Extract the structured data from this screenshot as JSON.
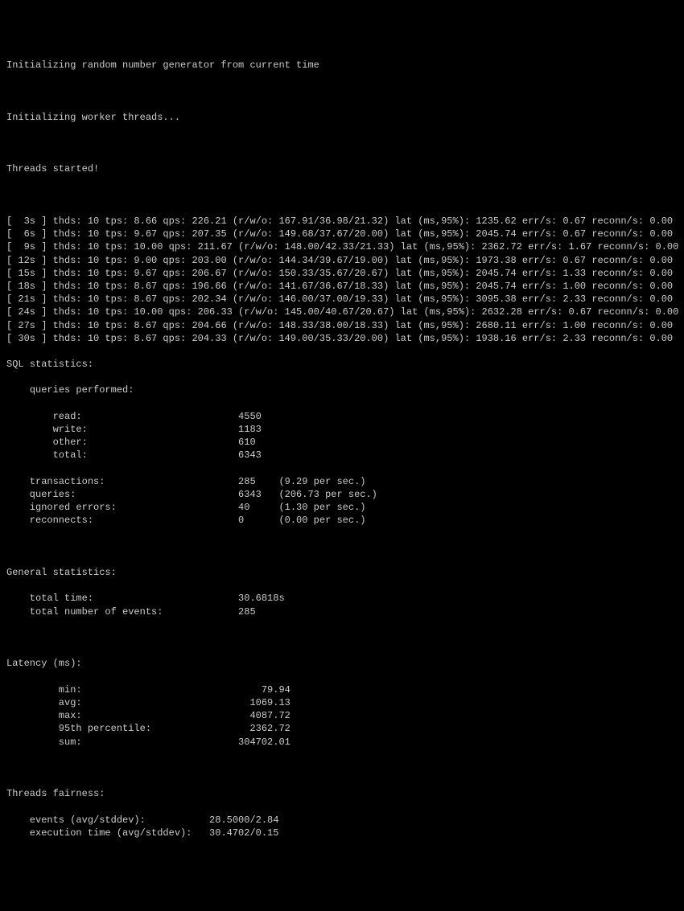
{
  "header": {
    "init_rng": "Initializing random number generator from current time",
    "init_workers": "Initializing worker threads...",
    "threads_started": "Threads started!"
  },
  "progress": [
    {
      "t": "3s",
      "thds": 10,
      "tps": "8.66",
      "qps": "226.21",
      "r": "167.91",
      "w": "36.98",
      "o": "21.32",
      "lat95": "1235.62",
      "err": "0.67",
      "reconn": "0.00"
    },
    {
      "t": "6s",
      "thds": 10,
      "tps": "9.67",
      "qps": "207.35",
      "r": "149.68",
      "w": "37.67",
      "o": "20.00",
      "lat95": "2045.74",
      "err": "0.67",
      "reconn": "0.00"
    },
    {
      "t": "9s",
      "thds": 10,
      "tps": "10.00",
      "qps": "211.67",
      "r": "148.00",
      "w": "42.33",
      "o": "21.33",
      "lat95": "2362.72",
      "err": "1.67",
      "reconn": "0.00"
    },
    {
      "t": "12s",
      "thds": 10,
      "tps": "9.00",
      "qps": "203.00",
      "r": "144.34",
      "w": "39.67",
      "o": "19.00",
      "lat95": "1973.38",
      "err": "0.67",
      "reconn": "0.00"
    },
    {
      "t": "15s",
      "thds": 10,
      "tps": "9.67",
      "qps": "206.67",
      "r": "150.33",
      "w": "35.67",
      "o": "20.67",
      "lat95": "2045.74",
      "err": "1.33",
      "reconn": "0.00"
    },
    {
      "t": "18s",
      "thds": 10,
      "tps": "8.67",
      "qps": "196.66",
      "r": "141.67",
      "w": "36.67",
      "o": "18.33",
      "lat95": "2045.74",
      "err": "1.00",
      "reconn": "0.00"
    },
    {
      "t": "21s",
      "thds": 10,
      "tps": "8.67",
      "qps": "202.34",
      "r": "146.00",
      "w": "37.00",
      "o": "19.33",
      "lat95": "3095.38",
      "err": "2.33",
      "reconn": "0.00"
    },
    {
      "t": "24s",
      "thds": 10,
      "tps": "10.00",
      "qps": "206.33",
      "r": "145.00",
      "w": "40.67",
      "o": "20.67",
      "lat95": "2632.28",
      "err": "0.67",
      "reconn": "0.00"
    },
    {
      "t": "27s",
      "thds": 10,
      "tps": "8.67",
      "qps": "204.66",
      "r": "148.33",
      "w": "38.00",
      "o": "18.33",
      "lat95": "2680.11",
      "err": "1.00",
      "reconn": "0.00"
    },
    {
      "t": "30s",
      "thds": 10,
      "tps": "8.67",
      "qps": "204.33",
      "r": "149.00",
      "w": "35.33",
      "o": "20.00",
      "lat95": "1938.16",
      "err": "2.33",
      "reconn": "0.00"
    }
  ],
  "sql": {
    "heading": "SQL statistics:",
    "queries_performed": "queries performed:",
    "read": {
      "label": "read:",
      "value": "4550"
    },
    "write": {
      "label": "write:",
      "value": "1183"
    },
    "other": {
      "label": "other:",
      "value": "610"
    },
    "total": {
      "label": "total:",
      "value": "6343"
    },
    "transactions": {
      "label": "transactions:",
      "value": "285",
      "rate": "(9.29 per sec.)"
    },
    "queries": {
      "label": "queries:",
      "value": "6343",
      "rate": "(206.73 per sec.)"
    },
    "ignored_errors": {
      "label": "ignored errors:",
      "value": "40",
      "rate": "(1.30 per sec.)"
    },
    "reconnects": {
      "label": "reconnects:",
      "value": "0",
      "rate": "(0.00 per sec.)"
    }
  },
  "general": {
    "heading": "General statistics:",
    "total_time": {
      "label": "total time:",
      "value": "30.6818s"
    },
    "total_events": {
      "label": "total number of events:",
      "value": "285"
    }
  },
  "latency": {
    "heading": "Latency (ms):",
    "min": {
      "label": "min:",
      "value": "79.94"
    },
    "avg": {
      "label": "avg:",
      "value": "1069.13"
    },
    "max": {
      "label": "max:",
      "value": "4087.72"
    },
    "p95": {
      "label": "95th percentile:",
      "value": "2362.72"
    },
    "sum": {
      "label": "sum:",
      "value": "304702.01"
    }
  },
  "fairness": {
    "heading": "Threads fairness:",
    "events": {
      "label": "events (avg/stddev):",
      "value": "28.5000/2.84"
    },
    "exec": {
      "label": "execution time (avg/stddev):",
      "value": "30.4702/0.15"
    }
  }
}
